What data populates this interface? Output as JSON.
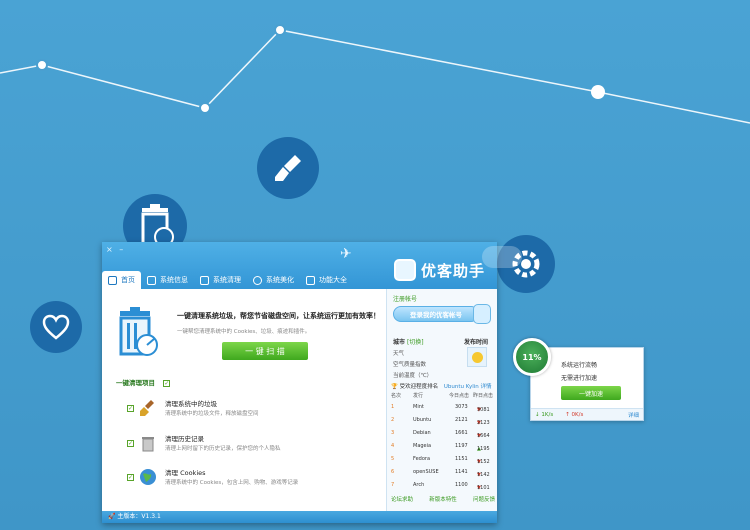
{
  "window": {
    "close_glyph": "×",
    "min_glyph": "–",
    "brand": "优客助手",
    "tabs": [
      "首页",
      "系统信息",
      "系统清理",
      "系统美化",
      "功能大全"
    ],
    "active_tab": 0
  },
  "home": {
    "headline": "一键清理系统垃圾，帮您节省磁盘空间，让系统运行更加有效率！",
    "subline": "一键帮您清理系统中的 Cookies、垃圾、痕迹和插件。",
    "scan_button": "一 键 扫 描",
    "section_title": "一键清理项目",
    "check_mark": "✓",
    "items": [
      {
        "title": "清理系统中的垃圾",
        "desc": "清理系统中的垃圾文件，释放磁盘空间"
      },
      {
        "title": "清理历史记录",
        "desc": "清理上网时留下的历史记录，保护您的个人隐私"
      },
      {
        "title": "清理 Cookies",
        "desc": "清理系统中的 Cookies，包含上网、购物、游戏等记录"
      }
    ]
  },
  "status_bar": "主版本：V1.3.1",
  "sidebar": {
    "register_title": "注册帐号",
    "login_button": "登录我的优客帐号",
    "city_label": "城市",
    "city_switch": "[切换]",
    "weather": "天气",
    "air": "空气质量指数",
    "temp": "当前温度（℃）",
    "publish_time": "发布时间",
    "rank_title": "受欢迎程度排名",
    "rank_link": "Ubuntu Kylin 详情",
    "rank_cols": [
      "名次",
      "发行",
      "今日点击",
      "昨日点击"
    ],
    "ranks": [
      {
        "rank": "1",
        "name": "Mint",
        "today": "3073",
        "yesterday": "3081",
        "dir": "down"
      },
      {
        "rank": "2",
        "name": "Ubuntu",
        "today": "2121",
        "yesterday": "2123",
        "dir": "down"
      },
      {
        "rank": "3",
        "name": "Debian",
        "today": "1661",
        "yesterday": "1664",
        "dir": "down"
      },
      {
        "rank": "4",
        "name": "Mageia",
        "today": "1197",
        "yesterday": "1195",
        "dir": "up"
      },
      {
        "rank": "5",
        "name": "Fedora",
        "today": "1151",
        "yesterday": "1152",
        "dir": "down"
      },
      {
        "rank": "6",
        "name": "openSUSE",
        "today": "1141",
        "yesterday": "1142",
        "dir": "down"
      },
      {
        "rank": "7",
        "name": "Arch",
        "today": "1100",
        "yesterday": "1101",
        "dir": "down"
      }
    ],
    "links": [
      "论坛求助",
      "新版本特性",
      "问题反馈"
    ]
  },
  "popup": {
    "percent": "11%",
    "line1": "系统运行流畅",
    "line2": "无需进行加速",
    "button": "一键加速",
    "download": "1K/s",
    "upload": "0K/s",
    "more": "详细"
  },
  "colors": {
    "background": "#4a9fd0",
    "accent_green": "#3fa81e",
    "dark_circle": "#1d6aa8"
  }
}
